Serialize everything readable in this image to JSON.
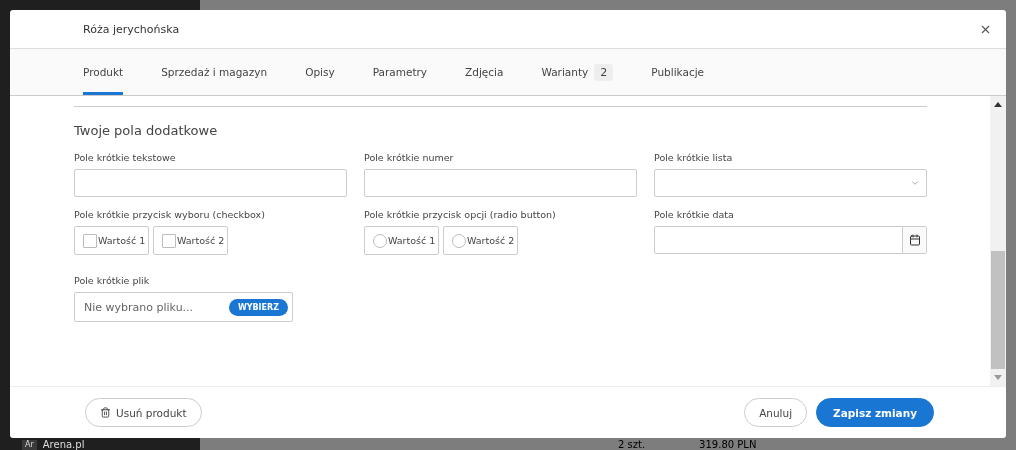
{
  "background": {
    "store_badge": "Ar",
    "store_name": "Arena.pl",
    "quantity": "2 szt.",
    "price": "319.80 PLN"
  },
  "modal": {
    "title": "Róża jerychońska",
    "tabs": [
      {
        "label": "Produkt",
        "selected": true
      },
      {
        "label": "Sprzedaż i magazyn",
        "selected": false
      },
      {
        "label": "Opisy",
        "selected": false
      },
      {
        "label": "Parametry",
        "selected": false
      },
      {
        "label": "Zdjęcia",
        "selected": false
      },
      {
        "label": "Warianty",
        "count": "2",
        "selected": false
      },
      {
        "label": "Publikacje",
        "selected": false
      }
    ],
    "section_title": "Twoje pola dodatkowe",
    "fields": [
      {
        "kind": "text",
        "label": "Pole krótkie tekstowe"
      },
      {
        "kind": "text",
        "label": "Pole krótkie numer"
      },
      {
        "kind": "select",
        "label": "Pole krótkie lista"
      },
      {
        "kind": "checkbox",
        "label": "Pole krótkie przycisk wyboru (checkbox)",
        "options": [
          {
            "label": "Wartość 1",
            "checked": false
          },
          {
            "label": "Wartość 2",
            "checked": false
          }
        ]
      },
      {
        "kind": "radio",
        "label": "Pole krótkie przycisk opcji (radio button)",
        "options": [
          {
            "label": "Wartość 1",
            "selected": false
          },
          {
            "label": "Wartość 2",
            "selected": false
          }
        ]
      },
      {
        "kind": "date",
        "label": "Pole krótkie data"
      },
      {
        "kind": "file",
        "label": "Pole krótkie plik",
        "placeholder": "Nie wybrano pliku...",
        "button": "WYBIERZ"
      }
    ],
    "footer": {
      "delete_button": "Usuń produkt",
      "cancel_button": "Anuluj",
      "save_button": "Zapisz zmiany"
    }
  }
}
